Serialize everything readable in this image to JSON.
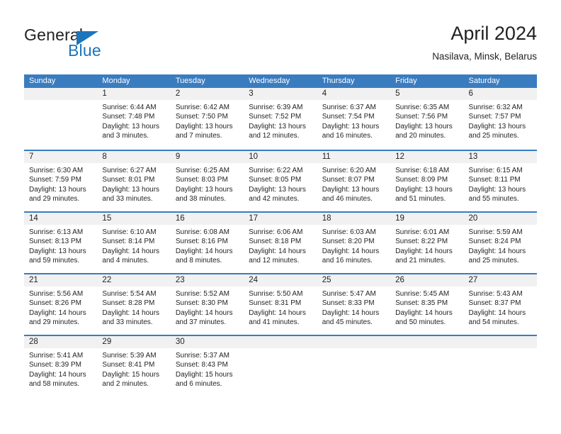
{
  "brand": {
    "name_part1": "General",
    "name_part2": "Blue",
    "triangle_color": "#1b75bb",
    "text_color": "#231f20"
  },
  "header": {
    "title": "April 2024",
    "subtitle": "Nasilava, Minsk, Belarus"
  },
  "theme": {
    "header_bg": "#3a7cc0",
    "header_text": "#ffffff",
    "day_band_bg": "#f1f1f1",
    "body_text": "#231f20",
    "divider": "#3a7cc0"
  },
  "weekdays": [
    "Sunday",
    "Monday",
    "Tuesday",
    "Wednesday",
    "Thursday",
    "Friday",
    "Saturday"
  ],
  "weeks": [
    {
      "days": [
        {
          "number": "",
          "sunrise": "",
          "sunset": "",
          "daylight_line1": "",
          "daylight_line2": "",
          "empty": true
        },
        {
          "number": "1",
          "sunrise": "Sunrise: 6:44 AM",
          "sunset": "Sunset: 7:48 PM",
          "daylight_line1": "Daylight: 13 hours",
          "daylight_line2": "and 3 minutes.",
          "empty": false
        },
        {
          "number": "2",
          "sunrise": "Sunrise: 6:42 AM",
          "sunset": "Sunset: 7:50 PM",
          "daylight_line1": "Daylight: 13 hours",
          "daylight_line2": "and 7 minutes.",
          "empty": false
        },
        {
          "number": "3",
          "sunrise": "Sunrise: 6:39 AM",
          "sunset": "Sunset: 7:52 PM",
          "daylight_line1": "Daylight: 13 hours",
          "daylight_line2": "and 12 minutes.",
          "empty": false
        },
        {
          "number": "4",
          "sunrise": "Sunrise: 6:37 AM",
          "sunset": "Sunset: 7:54 PM",
          "daylight_line1": "Daylight: 13 hours",
          "daylight_line2": "and 16 minutes.",
          "empty": false
        },
        {
          "number": "5",
          "sunrise": "Sunrise: 6:35 AM",
          "sunset": "Sunset: 7:56 PM",
          "daylight_line1": "Daylight: 13 hours",
          "daylight_line2": "and 20 minutes.",
          "empty": false
        },
        {
          "number": "6",
          "sunrise": "Sunrise: 6:32 AM",
          "sunset": "Sunset: 7:57 PM",
          "daylight_line1": "Daylight: 13 hours",
          "daylight_line2": "and 25 minutes.",
          "empty": false
        }
      ]
    },
    {
      "days": [
        {
          "number": "7",
          "sunrise": "Sunrise: 6:30 AM",
          "sunset": "Sunset: 7:59 PM",
          "daylight_line1": "Daylight: 13 hours",
          "daylight_line2": "and 29 minutes.",
          "empty": false
        },
        {
          "number": "8",
          "sunrise": "Sunrise: 6:27 AM",
          "sunset": "Sunset: 8:01 PM",
          "daylight_line1": "Daylight: 13 hours",
          "daylight_line2": "and 33 minutes.",
          "empty": false
        },
        {
          "number": "9",
          "sunrise": "Sunrise: 6:25 AM",
          "sunset": "Sunset: 8:03 PM",
          "daylight_line1": "Daylight: 13 hours",
          "daylight_line2": "and 38 minutes.",
          "empty": false
        },
        {
          "number": "10",
          "sunrise": "Sunrise: 6:22 AM",
          "sunset": "Sunset: 8:05 PM",
          "daylight_line1": "Daylight: 13 hours",
          "daylight_line2": "and 42 minutes.",
          "empty": false
        },
        {
          "number": "11",
          "sunrise": "Sunrise: 6:20 AM",
          "sunset": "Sunset: 8:07 PM",
          "daylight_line1": "Daylight: 13 hours",
          "daylight_line2": "and 46 minutes.",
          "empty": false
        },
        {
          "number": "12",
          "sunrise": "Sunrise: 6:18 AM",
          "sunset": "Sunset: 8:09 PM",
          "daylight_line1": "Daylight: 13 hours",
          "daylight_line2": "and 51 minutes.",
          "empty": false
        },
        {
          "number": "13",
          "sunrise": "Sunrise: 6:15 AM",
          "sunset": "Sunset: 8:11 PM",
          "daylight_line1": "Daylight: 13 hours",
          "daylight_line2": "and 55 minutes.",
          "empty": false
        }
      ]
    },
    {
      "days": [
        {
          "number": "14",
          "sunrise": "Sunrise: 6:13 AM",
          "sunset": "Sunset: 8:13 PM",
          "daylight_line1": "Daylight: 13 hours",
          "daylight_line2": "and 59 minutes.",
          "empty": false
        },
        {
          "number": "15",
          "sunrise": "Sunrise: 6:10 AM",
          "sunset": "Sunset: 8:14 PM",
          "daylight_line1": "Daylight: 14 hours",
          "daylight_line2": "and 4 minutes.",
          "empty": false
        },
        {
          "number": "16",
          "sunrise": "Sunrise: 6:08 AM",
          "sunset": "Sunset: 8:16 PM",
          "daylight_line1": "Daylight: 14 hours",
          "daylight_line2": "and 8 minutes.",
          "empty": false
        },
        {
          "number": "17",
          "sunrise": "Sunrise: 6:06 AM",
          "sunset": "Sunset: 8:18 PM",
          "daylight_line1": "Daylight: 14 hours",
          "daylight_line2": "and 12 minutes.",
          "empty": false
        },
        {
          "number": "18",
          "sunrise": "Sunrise: 6:03 AM",
          "sunset": "Sunset: 8:20 PM",
          "daylight_line1": "Daylight: 14 hours",
          "daylight_line2": "and 16 minutes.",
          "empty": false
        },
        {
          "number": "19",
          "sunrise": "Sunrise: 6:01 AM",
          "sunset": "Sunset: 8:22 PM",
          "daylight_line1": "Daylight: 14 hours",
          "daylight_line2": "and 21 minutes.",
          "empty": false
        },
        {
          "number": "20",
          "sunrise": "Sunrise: 5:59 AM",
          "sunset": "Sunset: 8:24 PM",
          "daylight_line1": "Daylight: 14 hours",
          "daylight_line2": "and 25 minutes.",
          "empty": false
        }
      ]
    },
    {
      "days": [
        {
          "number": "21",
          "sunrise": "Sunrise: 5:56 AM",
          "sunset": "Sunset: 8:26 PM",
          "daylight_line1": "Daylight: 14 hours",
          "daylight_line2": "and 29 minutes.",
          "empty": false
        },
        {
          "number": "22",
          "sunrise": "Sunrise: 5:54 AM",
          "sunset": "Sunset: 8:28 PM",
          "daylight_line1": "Daylight: 14 hours",
          "daylight_line2": "and 33 minutes.",
          "empty": false
        },
        {
          "number": "23",
          "sunrise": "Sunrise: 5:52 AM",
          "sunset": "Sunset: 8:30 PM",
          "daylight_line1": "Daylight: 14 hours",
          "daylight_line2": "and 37 minutes.",
          "empty": false
        },
        {
          "number": "24",
          "sunrise": "Sunrise: 5:50 AM",
          "sunset": "Sunset: 8:31 PM",
          "daylight_line1": "Daylight: 14 hours",
          "daylight_line2": "and 41 minutes.",
          "empty": false
        },
        {
          "number": "25",
          "sunrise": "Sunrise: 5:47 AM",
          "sunset": "Sunset: 8:33 PM",
          "daylight_line1": "Daylight: 14 hours",
          "daylight_line2": "and 45 minutes.",
          "empty": false
        },
        {
          "number": "26",
          "sunrise": "Sunrise: 5:45 AM",
          "sunset": "Sunset: 8:35 PM",
          "daylight_line1": "Daylight: 14 hours",
          "daylight_line2": "and 50 minutes.",
          "empty": false
        },
        {
          "number": "27",
          "sunrise": "Sunrise: 5:43 AM",
          "sunset": "Sunset: 8:37 PM",
          "daylight_line1": "Daylight: 14 hours",
          "daylight_line2": "and 54 minutes.",
          "empty": false
        }
      ]
    },
    {
      "days": [
        {
          "number": "28",
          "sunrise": "Sunrise: 5:41 AM",
          "sunset": "Sunset: 8:39 PM",
          "daylight_line1": "Daylight: 14 hours",
          "daylight_line2": "and 58 minutes.",
          "empty": false
        },
        {
          "number": "29",
          "sunrise": "Sunrise: 5:39 AM",
          "sunset": "Sunset: 8:41 PM",
          "daylight_line1": "Daylight: 15 hours",
          "daylight_line2": "and 2 minutes.",
          "empty": false
        },
        {
          "number": "30",
          "sunrise": "Sunrise: 5:37 AM",
          "sunset": "Sunset: 8:43 PM",
          "daylight_line1": "Daylight: 15 hours",
          "daylight_line2": "and 6 minutes.",
          "empty": false
        },
        {
          "number": "",
          "sunrise": "",
          "sunset": "",
          "daylight_line1": "",
          "daylight_line2": "",
          "empty": true
        },
        {
          "number": "",
          "sunrise": "",
          "sunset": "",
          "daylight_line1": "",
          "daylight_line2": "",
          "empty": true
        },
        {
          "number": "",
          "sunrise": "",
          "sunset": "",
          "daylight_line1": "",
          "daylight_line2": "",
          "empty": true
        },
        {
          "number": "",
          "sunrise": "",
          "sunset": "",
          "daylight_line1": "",
          "daylight_line2": "",
          "empty": true
        }
      ]
    }
  ]
}
